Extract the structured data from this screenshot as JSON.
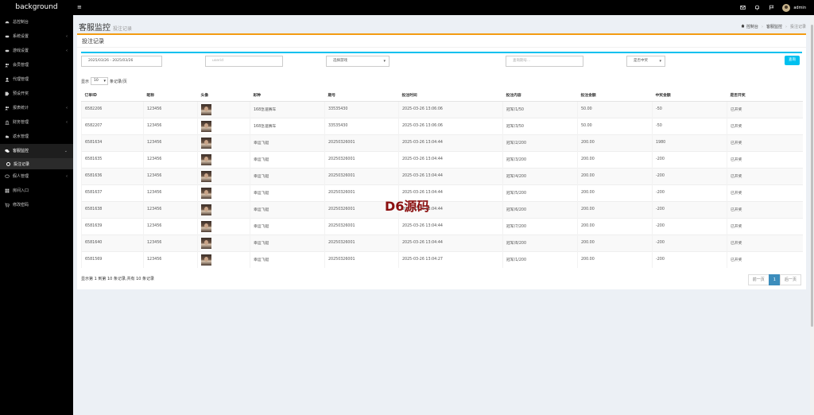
{
  "header": {
    "brand": "background",
    "menu_icon": "hamburger-icon",
    "admin": "admin",
    "icons": [
      "mail-icon",
      "bell-icon",
      "flag-icon",
      "avatar"
    ]
  },
  "sidebar": {
    "items": [
      {
        "label": "总控制台",
        "icon": "dashboard-icon"
      },
      {
        "label": "系统设置",
        "icon": "settings-icon",
        "chev": "‹"
      },
      {
        "label": "游戏设置",
        "icon": "gamepad-icon",
        "chev": "‹"
      },
      {
        "label": "会员管理",
        "icon": "users-icon"
      },
      {
        "label": "代理管理",
        "icon": "user-icon"
      },
      {
        "label": "预设开奖",
        "icon": "tag-icon"
      },
      {
        "label": "报表统计",
        "icon": "users-icon",
        "chev": "‹"
      },
      {
        "label": "财务管理",
        "icon": "bank-icon",
        "chev": "‹"
      },
      {
        "label": "返水管理",
        "icon": "cloud-icon"
      },
      {
        "label": "客服监控",
        "icon": "comments-icon",
        "chev": "⌄",
        "active": true
      },
      {
        "label": "投注记录",
        "sub": true
      },
      {
        "label": "假人管理",
        "icon": "comment-icon",
        "chev": "‹"
      },
      {
        "label": "房间入口",
        "icon": "grid-icon"
      },
      {
        "label": "修改密码",
        "icon": "cart-icon"
      }
    ]
  },
  "page": {
    "title": "客服监控",
    "subtitle": "投注记录",
    "breadcrumb": {
      "home": "控制台",
      "section": "客服监控",
      "current": "投注记录"
    }
  },
  "box": {
    "title": "投注记录"
  },
  "filters": {
    "date_range": "2025/03/26 - 2025/03/26",
    "userid_placeholder": "userid",
    "game_select": "选择游戏",
    "period_placeholder": "查询期号...",
    "win_select": "是否中奖",
    "search_button": "查询"
  },
  "page_size": {
    "prefix": "显示",
    "value": "10",
    "suffix": "条记录/页"
  },
  "table": {
    "headers": [
      "订单ID",
      "昵称",
      "头像",
      "彩种",
      "期号",
      "投注时间",
      "投注内容",
      "投注金额",
      "中奖金额",
      "是否开奖"
    ],
    "rows": [
      [
        "6582206",
        "123456",
        "",
        "168急速赛车",
        "33535430",
        "2025-03-26 13:06:06",
        "冠军/1/50",
        "50.00",
        "-50",
        "已开奖"
      ],
      [
        "6582207",
        "123456",
        "",
        "168急速赛车",
        "33535430",
        "2025-03-26 13:06:06",
        "冠军/3/50",
        "50.00",
        "-50",
        "已开奖"
      ],
      [
        "6581634",
        "123456",
        "",
        "幸运飞艇",
        "20250326001",
        "2025-03-26 13:04:44",
        "冠军/2/200",
        "200.00",
        "1980",
        "已开奖"
      ],
      [
        "6581635",
        "123456",
        "",
        "幸运飞艇",
        "20250326001",
        "2025-03-26 13:04:44",
        "冠军/3/200",
        "200.00",
        "-200",
        "已开奖"
      ],
      [
        "6581636",
        "123456",
        "",
        "幸运飞艇",
        "20250326001",
        "2025-03-26 13:04:44",
        "冠军/4/200",
        "200.00",
        "-200",
        "已开奖"
      ],
      [
        "6581637",
        "123456",
        "",
        "幸运飞艇",
        "20250326001",
        "2025-03-26 13:04:44",
        "冠军/5/200",
        "200.00",
        "-200",
        "已开奖"
      ],
      [
        "6581638",
        "123456",
        "",
        "幸运飞艇",
        "20250326001",
        "2025-03-26 13:04:44",
        "冠军/6/200",
        "200.00",
        "-200",
        "已开奖"
      ],
      [
        "6581639",
        "123456",
        "",
        "幸运飞艇",
        "20250326001",
        "2025-03-26 13:04:44",
        "冠军/7/200",
        "200.00",
        "-200",
        "已开奖"
      ],
      [
        "6581640",
        "123456",
        "",
        "幸运飞艇",
        "20250326001",
        "2025-03-26 13:04:44",
        "冠军/8/200",
        "200.00",
        "-200",
        "已开奖"
      ],
      [
        "6581569",
        "123456",
        "",
        "幸运飞艇",
        "20250326001",
        "2025-03-26 13:04:27",
        "冠军/1/200",
        "200.00",
        "-200",
        "已开奖"
      ]
    ]
  },
  "footer": {
    "info": "显示第 1 到第 10 条记录,共有 10 条记录",
    "prev": "前一页",
    "page": "1",
    "next": "后一页"
  },
  "watermark": "D6源码",
  "colors": {
    "accent": "#00c0ef",
    "header": "#000000",
    "box_top": "#f39c12",
    "pager_active": "#3c8dbc"
  }
}
